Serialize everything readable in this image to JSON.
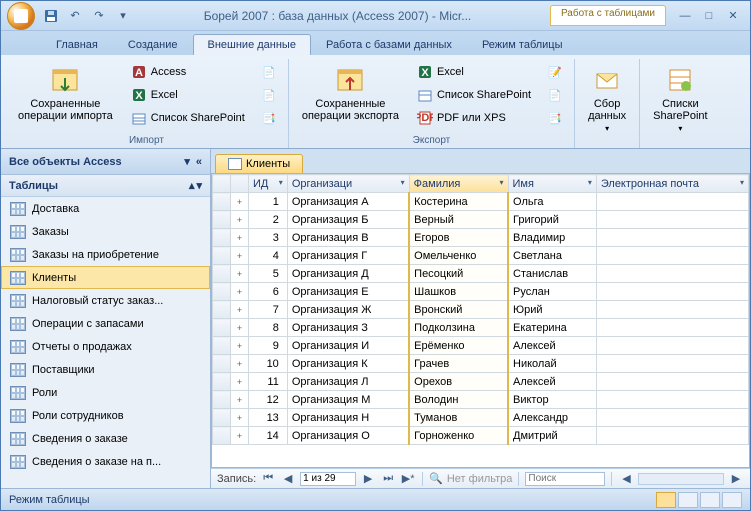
{
  "title": "Борей 2007 : база данных (Access 2007) - Micr...",
  "context_tab": "Работа с таблицами",
  "tabs": [
    "Главная",
    "Создание",
    "Внешние данные",
    "Работа с базами данных",
    "Режим таблицы"
  ],
  "active_tab": 2,
  "ribbon": {
    "groups": [
      {
        "label": "Импорт",
        "big": [
          {
            "label": "Сохраненные\nоперации импорта"
          }
        ],
        "small": [
          "Access",
          "Excel",
          "Список SharePoint"
        ]
      },
      {
        "label": "Экспорт",
        "big": [
          {
            "label": "Сохраненные\nоперации экспорта"
          }
        ],
        "small": [
          "Excel",
          "Список SharePoint",
          "PDF или XPS"
        ]
      },
      {
        "label": "",
        "big": [
          {
            "label": "Сбор\nданных"
          }
        ]
      },
      {
        "label": "",
        "big": [
          {
            "label": "Списки\nSharePoint"
          }
        ]
      }
    ]
  },
  "navpane": {
    "title": "Все объекты Access",
    "category": "Таблицы",
    "items": [
      "Доставка",
      "Заказы",
      "Заказы на приобретение",
      "Клиенты",
      "Налоговый статус заказ...",
      "Операции с запасами",
      "Отчеты о продажах",
      "Поставщики",
      "Роли",
      "Роли сотрудников",
      "Сведения о заказе",
      "Сведения о заказе на п..."
    ],
    "selected": 3
  },
  "datasheet": {
    "tab": "Клиенты",
    "columns": [
      "ИД",
      "Организаци",
      "Фамилия",
      "Имя",
      "Электронная почта"
    ],
    "sorted_col": 2,
    "rows": [
      {
        "id": 1,
        "org": "Организация А",
        "fam": "Костерина",
        "name": "Ольга"
      },
      {
        "id": 2,
        "org": "Организация Б",
        "fam": "Верный",
        "name": "Григорий"
      },
      {
        "id": 3,
        "org": "Организация В",
        "fam": "Егоров",
        "name": "Владимир"
      },
      {
        "id": 4,
        "org": "Организация Г",
        "fam": "Омельченко",
        "name": "Светлана"
      },
      {
        "id": 5,
        "org": "Организация Д",
        "fam": "Песоцкий",
        "name": "Станислав"
      },
      {
        "id": 6,
        "org": "Организация Е",
        "fam": "Шашков",
        "name": "Руслан"
      },
      {
        "id": 7,
        "org": "Организация Ж",
        "fam": "Вронский",
        "name": "Юрий"
      },
      {
        "id": 8,
        "org": "Организация З",
        "fam": "Подколзина",
        "name": "Екатерина"
      },
      {
        "id": 9,
        "org": "Организация И",
        "fam": "Ерёменко",
        "name": "Алексей"
      },
      {
        "id": 10,
        "org": "Организация К",
        "fam": "Грачев",
        "name": "Николай"
      },
      {
        "id": 11,
        "org": "Организация Л",
        "fam": "Орехов",
        "name": "Алексей"
      },
      {
        "id": 12,
        "org": "Организация М",
        "fam": "Володин",
        "name": "Виктор"
      },
      {
        "id": 13,
        "org": "Организация Н",
        "fam": "Туманов",
        "name": "Александр"
      },
      {
        "id": 14,
        "org": "Организация О",
        "fam": "Горноженко",
        "name": "Дмитрий"
      }
    ]
  },
  "recnav": {
    "label": "Запись:",
    "pos": "1 из 29",
    "filter": "Нет фильтра",
    "search": "Поиск"
  },
  "status": "Режим таблицы"
}
